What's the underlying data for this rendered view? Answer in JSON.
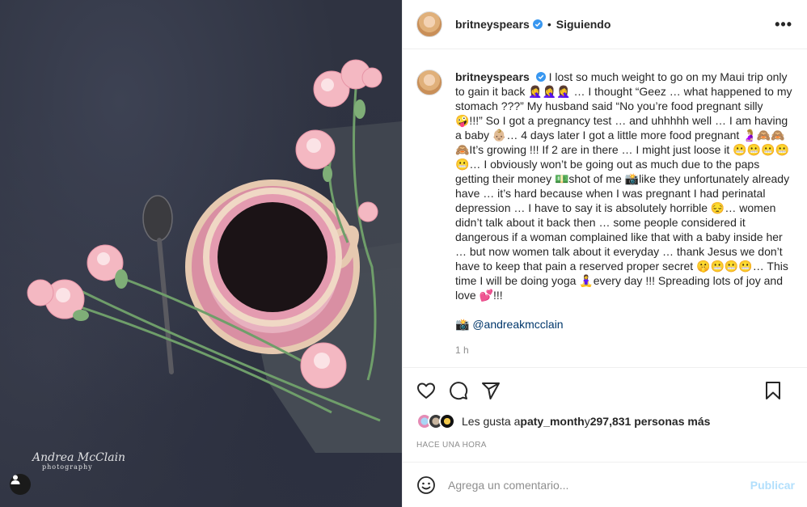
{
  "photo": {
    "watermark_line1": "Andrea McClain",
    "watermark_line2": "photography",
    "user_tag_icon": "person-icon"
  },
  "header": {
    "username": "britneyspears",
    "verified_icon": "verified-badge-icon",
    "separator": "•",
    "follow_state": "Siguiendo",
    "more_icon": "more-horizontal-icon",
    "more_glyph": "•••"
  },
  "caption": {
    "username": "britneyspears",
    "text": "I lost so much weight to go on my Maui trip only to gain it back 🤦‍♀️🤦‍♀️🤦‍♀️ … I thought “Geez … what happened to my stomach ???” My husband said “No you’re food pregnant silly 🤪!!!” So I got a pregnancy test … and uhhhhh well … I am having a baby 👶🏼… 4 days later I got a little more food pregnant 🤰🏼🙈🙈🙈It’s growing !!! If 2 are in there … I might just loose it 😬😬😬😬😬… I obviously won’t be going out as much due to the paps getting their money 💵shot of me 📸like they unfortunately already have … it’s hard because when I was pregnant I had perinatal depression … I have to say it is absolutely horrible 😔… women didn’t talk about it back then … some people considered it dangerous if a woman complained like that with a baby inside her … but now women talk about it everyday … thank Jesus we don’t have to keep that pain a reserved proper secret 🤫😬😬😬… This time I will be doing yoga 🧘‍♀️every day !!! Spreading lots of joy and love 💕!!!",
    "credit_prefix": "📸 ",
    "credit_mention": "@andreakmcclain",
    "time_ago": "1 h"
  },
  "actions": {
    "like_icon": "heart-icon",
    "comment_icon": "comment-icon",
    "share_icon": "share-icon",
    "save_icon": "bookmark-icon"
  },
  "likes": {
    "prefix": "Les gusta a ",
    "first_user": "paty_month",
    "conjunction": " y ",
    "others": "297,831 personas más"
  },
  "posted": "HACE UNA HORA",
  "comment": {
    "emoji_icon": "smiley-icon",
    "placeholder": "Agrega un comentario...",
    "publish_label": "Publicar"
  },
  "colors": {
    "accent": "#0095f6",
    "publish_disabled": "#b2dffc",
    "mention": "#00376b",
    "muted": "#8e8e8e",
    "divider": "#efefef"
  }
}
